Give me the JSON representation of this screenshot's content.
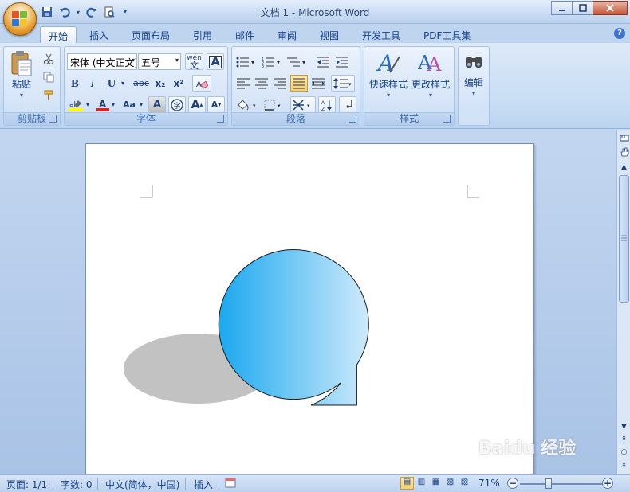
{
  "window": {
    "title": "文档 1 - Microsoft Word"
  },
  "qat": {
    "icons": [
      "save-icon",
      "undo-icon",
      "redo-icon",
      "print-preview-icon",
      "customize-icon"
    ]
  },
  "tabs": [
    {
      "label": "开始",
      "active": true
    },
    {
      "label": "插入"
    },
    {
      "label": "页面布局"
    },
    {
      "label": "引用"
    },
    {
      "label": "邮件"
    },
    {
      "label": "审阅"
    },
    {
      "label": "视图"
    },
    {
      "label": "开发工具"
    },
    {
      "label": "PDF工具集"
    }
  ],
  "ribbon": {
    "clipboard": {
      "title": "剪贴板",
      "paste": "粘贴"
    },
    "font": {
      "title": "字体",
      "font_name": "宋体 (中文正文)",
      "font_size": "五号",
      "bold": "B",
      "italic": "I",
      "underline": "U",
      "strike": "abc",
      "subscript": "x₂",
      "superscript": "x²",
      "change_case": "Aa",
      "grow": "A",
      "shrink": "A",
      "char_shading": "A",
      "phonetic": "wén"
    },
    "paragraph": {
      "title": "段落"
    },
    "styles": {
      "title": "样式",
      "quick_styles": "快速样式",
      "change_styles": "更改样式"
    },
    "editing": {
      "label": "编辑"
    }
  },
  "status": {
    "page": "页面: 1/1",
    "words": "字数: 0",
    "language": "中文(简体，中国)",
    "mode": "插入",
    "zoom": "71%",
    "zoom_fraction": 0.35
  },
  "watermark": {
    "text": "Baidu 经验"
  },
  "colors": {
    "shape_fill_start": "#1aa8ef",
    "shape_fill_end": "#cfeafb",
    "shadow": "#c2c2c2"
  }
}
